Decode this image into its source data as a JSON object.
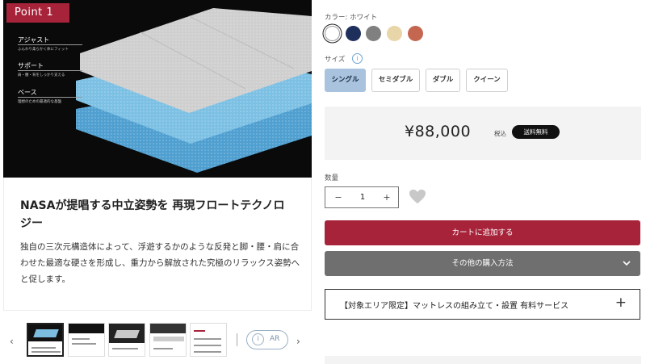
{
  "hero": {
    "badge": "Point 1",
    "layers": [
      {
        "label": "アジャスト",
        "sub": "ふんわり柔らかく体にフィット"
      },
      {
        "label": "サポート",
        "sub": "肩・腰・背をしっかり支える"
      },
      {
        "label": "ベース",
        "sub": "理想のための最適的な基盤"
      }
    ]
  },
  "caption": {
    "title": "NASAが提唱する中立姿勢を 再現フロートテクノロジー",
    "body": "独自の三次元構造体によって、浮遊するかのような反発と脚・腰・肩に合わせた最適な硬さを形成し、重力から解放された究極のリラックス姿勢へと促します。"
  },
  "gallery": {
    "prev": "‹",
    "next": "›",
    "ar_label": "AR",
    "ar_icon": "i",
    "thumbnails": 5
  },
  "product": {
    "color_label": "カラー: ホワイト",
    "colors": [
      {
        "name": "white",
        "hex": "#ffffff"
      },
      {
        "name": "navy",
        "hex": "#1f2f5c"
      },
      {
        "name": "gray",
        "hex": "#808080"
      },
      {
        "name": "beige",
        "hex": "#e8d5a8"
      },
      {
        "name": "terracotta",
        "hex": "#c46650"
      }
    ],
    "size_label": "サイズ",
    "info_icon": "i",
    "sizes": [
      "シングル",
      "セミダブル",
      "ダブル",
      "クイーン"
    ],
    "selected_size": "シングル",
    "price": "¥88,000",
    "tax_note": "税込",
    "shipping_badge": "送料無料",
    "qty_label": "数量",
    "qty_minus": "−",
    "qty_value": "1",
    "qty_plus": "+",
    "add_to_cart": "カートに追加する",
    "other_purchase": "その他の購入方法",
    "service": "【対象エリア限定】マットレスの組み立て・設置 有料サービス",
    "service_plus": "+"
  },
  "colors": {
    "accent": "#a7233a",
    "size_active": "#a9c3df",
    "ar_outline": "#9bb0c4"
  }
}
